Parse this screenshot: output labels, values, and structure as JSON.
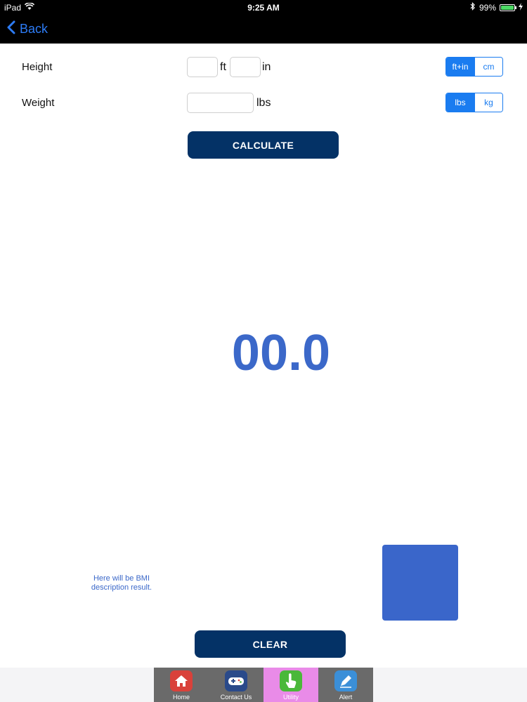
{
  "status_bar": {
    "device": "iPad",
    "time": "9:25 AM",
    "battery": "99%",
    "battery_level": 0.99
  },
  "nav": {
    "back_label": "Back"
  },
  "height": {
    "label": "Height",
    "ft_value": "",
    "in_value": "",
    "ft_unit": "ft",
    "in_unit": "in",
    "units": [
      "ft+in",
      "cm"
    ],
    "selected_unit": "ft+in"
  },
  "weight": {
    "label": "Weight",
    "value": "",
    "unit": "lbs",
    "units": [
      "lbs",
      "kg"
    ],
    "selected_unit": "lbs"
  },
  "calculate_label": "CALCULATE",
  "result": {
    "value": "00.0",
    "description": "Here will be BMI description result.",
    "color": "#3a66ca"
  },
  "clear_label": "CLEAR",
  "tabs": [
    {
      "label": "Home",
      "icon": "home-icon",
      "color": "#d9413a"
    },
    {
      "label": "Contact Us",
      "icon": "gamepad-icon",
      "color": "#2a4a8a"
    },
    {
      "label": "Utility",
      "icon": "hand-pointer-icon",
      "color": "#4ab83a"
    },
    {
      "label": "Alert",
      "icon": "pen-icon",
      "color": "#3b8fd8"
    }
  ],
  "selected_tab": "Utility"
}
